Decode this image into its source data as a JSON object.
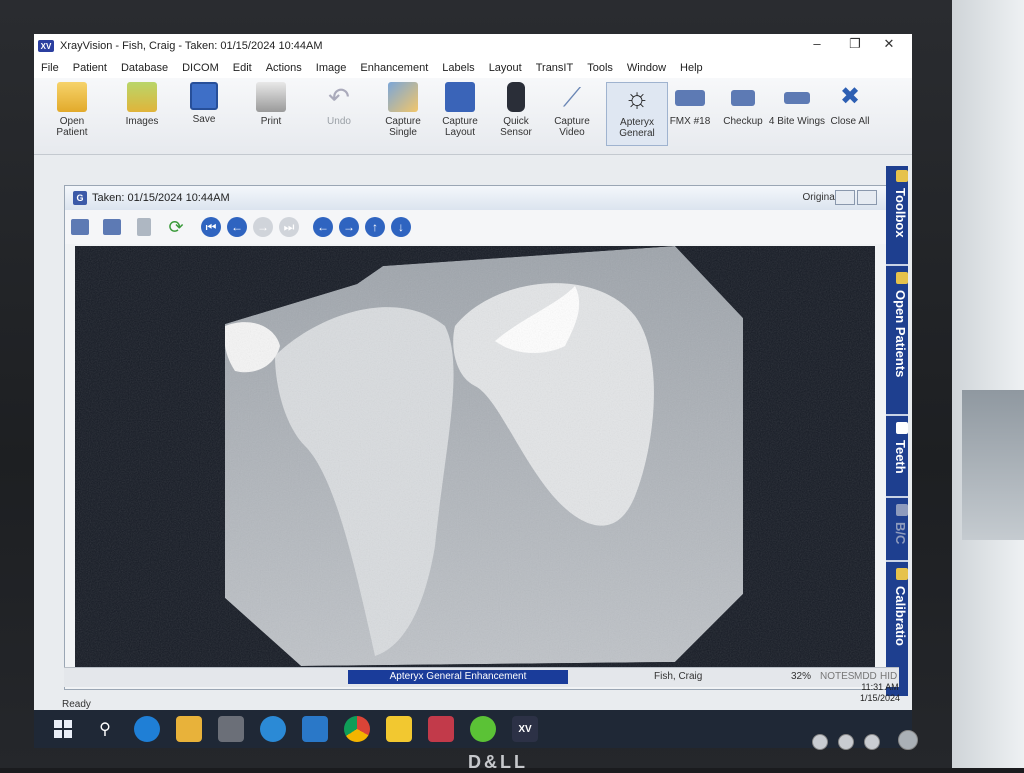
{
  "window": {
    "app_icon": "XV",
    "title": "XrayVision - Fish, Craig - Taken: 01/15/2024  10:44AM",
    "minimize": "–",
    "maximize": "❐",
    "close": "✕"
  },
  "menu": [
    "File",
    "Patient",
    "Database",
    "DICOM",
    "Edit",
    "Actions",
    "Image",
    "Enhancement",
    "Labels",
    "Layout",
    "TransIT",
    "Tools",
    "Window",
    "Help"
  ],
  "toolbar": [
    {
      "label1": "Open",
      "label2": "Patient",
      "icon": "open-patient-icon"
    },
    {
      "label1": "Images",
      "label2": "",
      "icon": "images-icon"
    },
    {
      "label1": "Save",
      "label2": "",
      "icon": "save-icon"
    },
    {
      "label1": "Print",
      "label2": "",
      "icon": "print-icon"
    },
    {
      "label1": "Undo",
      "label2": "",
      "icon": "undo-icon"
    },
    {
      "label1": "Capture",
      "label2": "Single",
      "icon": "capture-single-icon"
    },
    {
      "label1": "Capture",
      "label2": "Layout",
      "icon": "capture-layout-icon"
    },
    {
      "label1": "Quick",
      "label2": "Sensor",
      "icon": "quick-sensor-icon"
    },
    {
      "label1": "Capture",
      "label2": "Video",
      "icon": "capture-video-icon"
    },
    {
      "label1": "Apteryx",
      "label2": "General",
      "icon": "sun-icon"
    },
    {
      "label1": "FMX #18",
      "label2": "",
      "icon": "fmx-icon"
    },
    {
      "label1": "Checkup",
      "label2": "",
      "icon": "checkup-icon"
    },
    {
      "label1": "4 Bite Wings",
      "label2": "",
      "icon": "bite-wings-icon"
    },
    {
      "label1": "Close All",
      "label2": "",
      "icon": "close-all-icon"
    }
  ],
  "child": {
    "logo": "G",
    "title": "Taken: 01/15/2024  10:44AM",
    "mode": "Original"
  },
  "dock": {
    "tabs": [
      "Toolbox",
      "Open Patients",
      "Teeth",
      "B/C",
      "Calibratio"
    ]
  },
  "status": {
    "enhancement": "Apteryx General Enhancement",
    "patient": "Fish, Craig",
    "zoom": "32%",
    "notes": "NOTES",
    "mdd": "MDD",
    "hid": "HID",
    "ready": "Ready",
    "time": "11:31 AM",
    "date": "1/15/2024"
  },
  "taskbar": {
    "xv_label": "XV"
  },
  "monitor": {
    "brand": "D&LL"
  }
}
